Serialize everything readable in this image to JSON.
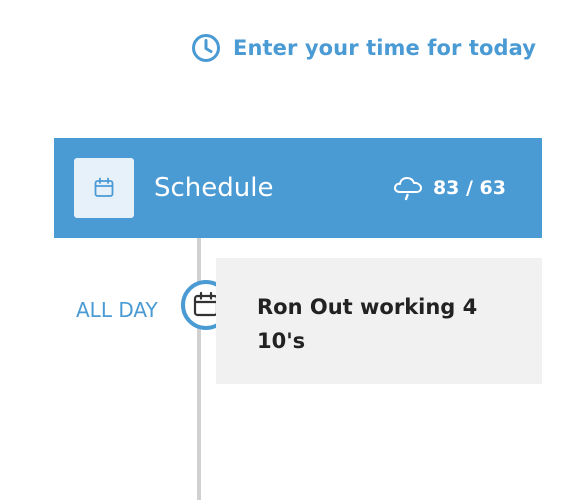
{
  "header": {
    "enter_time_label": "Enter your time for today"
  },
  "schedule": {
    "title": "Schedule",
    "weather": {
      "high": "83",
      "separator": "/",
      "low": "63",
      "text": "83 / 63",
      "icon": "cloud-rain-icon"
    }
  },
  "timeline": {
    "events": [
      {
        "time_label": "ALL DAY",
        "title": "Ron Out working 4 10's",
        "icon": "calendar-icon"
      }
    ]
  },
  "colors": {
    "accent": "#4a9ad4",
    "tile_background": "#e6f1fa",
    "card_background": "#f1f1f1",
    "timeline_line": "#d0d0d0",
    "text_dark": "#222222"
  }
}
